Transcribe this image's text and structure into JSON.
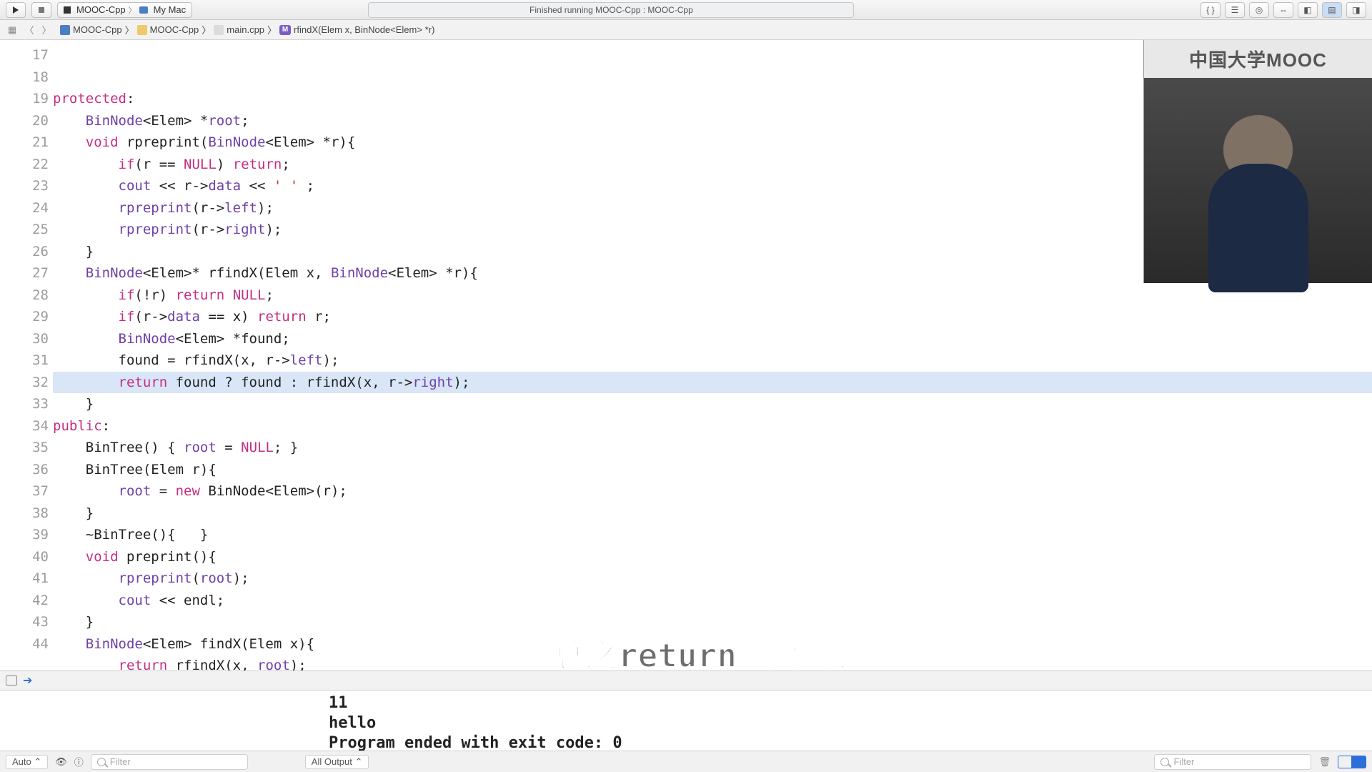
{
  "toolbar": {
    "scheme_project": "MOOC-Cpp",
    "scheme_target": "My Mac",
    "status": "Finished running MOOC-Cpp : MOOC-Cpp"
  },
  "jumpbar": {
    "parts": [
      {
        "icon": "proj",
        "label": "MOOC-Cpp"
      },
      {
        "icon": "folder",
        "label": "MOOC-Cpp"
      },
      {
        "icon": "cpp",
        "label": "main.cpp"
      },
      {
        "icon": "method",
        "label": "rfindX(Elem x, BinNode<Elem> *r)"
      }
    ]
  },
  "code": {
    "first_line_no": 17,
    "highlight_line": 30,
    "lines": [
      {
        "tokens": [
          [
            "k",
            "protected"
          ],
          [
            "pl",
            ":"
          ]
        ]
      },
      {
        "indent": 1,
        "tokens": [
          [
            "t",
            "BinNode"
          ],
          [
            "pl",
            "<Elem> *"
          ],
          [
            "t",
            "root"
          ],
          [
            "pl",
            ";"
          ]
        ]
      },
      {
        "indent": 1,
        "tokens": [
          [
            "k",
            "void"
          ],
          [
            "pl",
            " rpreprint("
          ],
          [
            "t",
            "BinNode"
          ],
          [
            "pl",
            "<Elem> *r){"
          ]
        ]
      },
      {
        "indent": 2,
        "tokens": [
          [
            "k",
            "if"
          ],
          [
            "pl",
            "(r == "
          ],
          [
            "k",
            "NULL"
          ],
          [
            "pl",
            ") "
          ],
          [
            "k",
            "return"
          ],
          [
            "pl",
            ";"
          ]
        ]
      },
      {
        "indent": 2,
        "tokens": [
          [
            "t",
            "cout"
          ],
          [
            "pl",
            " << r->"
          ],
          [
            "t",
            "data"
          ],
          [
            "pl",
            " << "
          ],
          [
            "s",
            "' '"
          ],
          [
            "pl",
            " ;"
          ]
        ]
      },
      {
        "indent": 2,
        "tokens": [
          [
            "t",
            "rpreprint"
          ],
          [
            "pl",
            "(r->"
          ],
          [
            "t",
            "left"
          ],
          [
            "pl",
            ");"
          ]
        ]
      },
      {
        "indent": 2,
        "tokens": [
          [
            "t",
            "rpreprint"
          ],
          [
            "pl",
            "(r->"
          ],
          [
            "t",
            "right"
          ],
          [
            "pl",
            ");"
          ]
        ]
      },
      {
        "indent": 1,
        "tokens": [
          [
            "pl",
            "}"
          ]
        ]
      },
      {
        "indent": 1,
        "tokens": [
          [
            "t",
            "BinNode"
          ],
          [
            "pl",
            "<Elem>* rfindX(Elem x, "
          ],
          [
            "t",
            "BinNode"
          ],
          [
            "pl",
            "<Elem> *r){"
          ]
        ]
      },
      {
        "indent": 2,
        "tokens": [
          [
            "k",
            "if"
          ],
          [
            "pl",
            "(!r) "
          ],
          [
            "k",
            "return"
          ],
          [
            "pl",
            " "
          ],
          [
            "k",
            "NULL"
          ],
          [
            "pl",
            ";"
          ]
        ]
      },
      {
        "indent": 2,
        "tokens": [
          [
            "k",
            "if"
          ],
          [
            "pl",
            "(r->"
          ],
          [
            "t",
            "data"
          ],
          [
            "pl",
            " == x) "
          ],
          [
            "k",
            "return"
          ],
          [
            "pl",
            " r;"
          ]
        ]
      },
      {
        "indent": 2,
        "tokens": [
          [
            "t",
            "BinNode"
          ],
          [
            "pl",
            "<Elem> *found;"
          ]
        ]
      },
      {
        "indent": 2,
        "tokens": [
          [
            "pl",
            "found = rfindX(x, r->"
          ],
          [
            "t",
            "left"
          ],
          [
            "pl",
            ");"
          ]
        ]
      },
      {
        "indent": 2,
        "tokens": [
          [
            "k",
            "return"
          ],
          [
            "pl",
            " found ? found : rfindX(x, r->"
          ],
          [
            "t",
            "right"
          ],
          [
            "pl",
            ");"
          ]
        ]
      },
      {
        "indent": 1,
        "tokens": [
          [
            "pl",
            "}"
          ]
        ]
      },
      {
        "tokens": [
          [
            "k",
            "public"
          ],
          [
            "pl",
            ":"
          ]
        ]
      },
      {
        "indent": 1,
        "tokens": [
          [
            "pl",
            "BinTree() { "
          ],
          [
            "t",
            "root"
          ],
          [
            "pl",
            " = "
          ],
          [
            "k",
            "NULL"
          ],
          [
            "pl",
            "; }"
          ]
        ]
      },
      {
        "indent": 1,
        "tokens": [
          [
            "pl",
            "BinTree(Elem r){"
          ]
        ]
      },
      {
        "indent": 2,
        "tokens": [
          [
            "t",
            "root"
          ],
          [
            "pl",
            " = "
          ],
          [
            "k",
            "new"
          ],
          [
            "pl",
            " BinNode<Elem>(r);"
          ]
        ]
      },
      {
        "indent": 1,
        "tokens": [
          [
            "pl",
            "}"
          ]
        ]
      },
      {
        "indent": 1,
        "tokens": [
          [
            "pl",
            "~BinTree(){   }"
          ]
        ]
      },
      {
        "indent": 1,
        "tokens": [
          [
            "k",
            "void"
          ],
          [
            "pl",
            " preprint(){"
          ]
        ]
      },
      {
        "indent": 2,
        "tokens": [
          [
            "t",
            "rpreprint"
          ],
          [
            "pl",
            "("
          ],
          [
            "t",
            "root"
          ],
          [
            "pl",
            ");"
          ]
        ]
      },
      {
        "indent": 2,
        "tokens": [
          [
            "t",
            "cout"
          ],
          [
            "pl",
            " << endl;"
          ]
        ]
      },
      {
        "indent": 1,
        "tokens": [
          [
            "pl",
            "}"
          ]
        ]
      },
      {
        "indent": 1,
        "tokens": [
          [
            "t",
            "BinNode"
          ],
          [
            "pl",
            "<Elem> findX(Elem x){"
          ]
        ]
      },
      {
        "indent": 2,
        "tokens": [
          [
            "k",
            "return"
          ],
          [
            "pl",
            " rfindX(x, "
          ],
          [
            "t",
            "root"
          ],
          [
            "pl",
            ");"
          ]
        ]
      },
      {
        "indent": 1,
        "tokens": [
          [
            "pl",
            "}"
          ]
        ]
      }
    ]
  },
  "console": {
    "lines": [
      "11",
      "hello",
      "Program ended with exit code: 0"
    ]
  },
  "bottom": {
    "auto_label": "Auto",
    "filter_placeholder": "Filter",
    "output_label": "All Output"
  },
  "overlay": {
    "subtitle": "总之return就没有错",
    "cam_logo": "中国大学MOOC"
  }
}
